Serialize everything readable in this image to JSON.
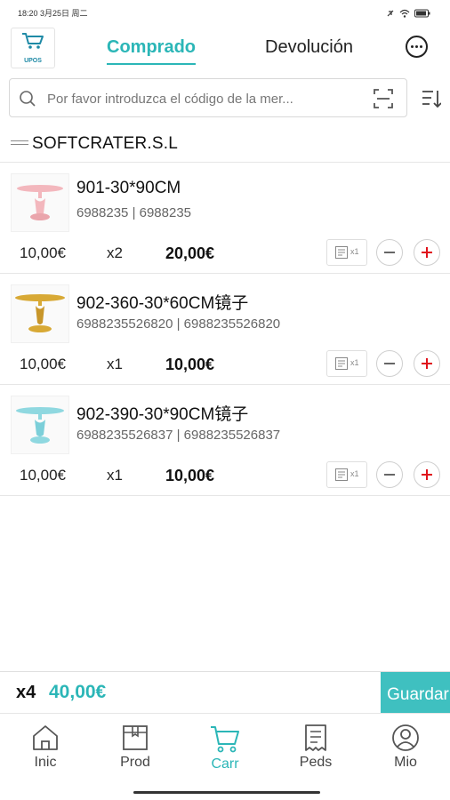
{
  "status_bar": {
    "time_date": "18:20 3月25日 周二"
  },
  "header": {
    "logo_text": "UPOS",
    "tab_active": "Comprado",
    "tab_inactive": "Devolución"
  },
  "search": {
    "placeholder": "Por favor introduzca el código de la mer..."
  },
  "company": {
    "name": "SOFTCRATER.S.L"
  },
  "items": [
    {
      "name": "901-30*90CM",
      "codes": "6988235 | 6988235",
      "price": "10,00€",
      "qty": "x2",
      "total": "20,00€",
      "note_count": "x1",
      "product_color": "#f3b7bd"
    },
    {
      "name": "902-360-30*60CM镜子",
      "codes": "6988235526820 | 6988235526820",
      "price": "10,00€",
      "qty": "x1",
      "total": "10,00€",
      "note_count": "x1",
      "product_color": "#d8a935"
    },
    {
      "name": "902-390-30*90CM镜子",
      "codes": "6988235526837 | 6988235526837",
      "price": "10,00€",
      "qty": "x1",
      "total": "10,00€",
      "note_count": "x1",
      "product_color": "#8fd8e0"
    }
  ],
  "summary": {
    "count": "x4",
    "amount": "40,00€",
    "save_label": "Guardar"
  },
  "bottom_nav": [
    {
      "label": "Inic",
      "icon": "home-icon"
    },
    {
      "label": "Prod",
      "icon": "box-icon"
    },
    {
      "label": "Carr",
      "icon": "cart-icon",
      "active": true
    },
    {
      "label": "Peds",
      "icon": "receipt-icon"
    },
    {
      "label": "Mio",
      "icon": "user-icon"
    }
  ],
  "colors": {
    "accent": "#2bb6b7",
    "save_button": "#3fc0c0",
    "plus_red": "#e0121b"
  }
}
